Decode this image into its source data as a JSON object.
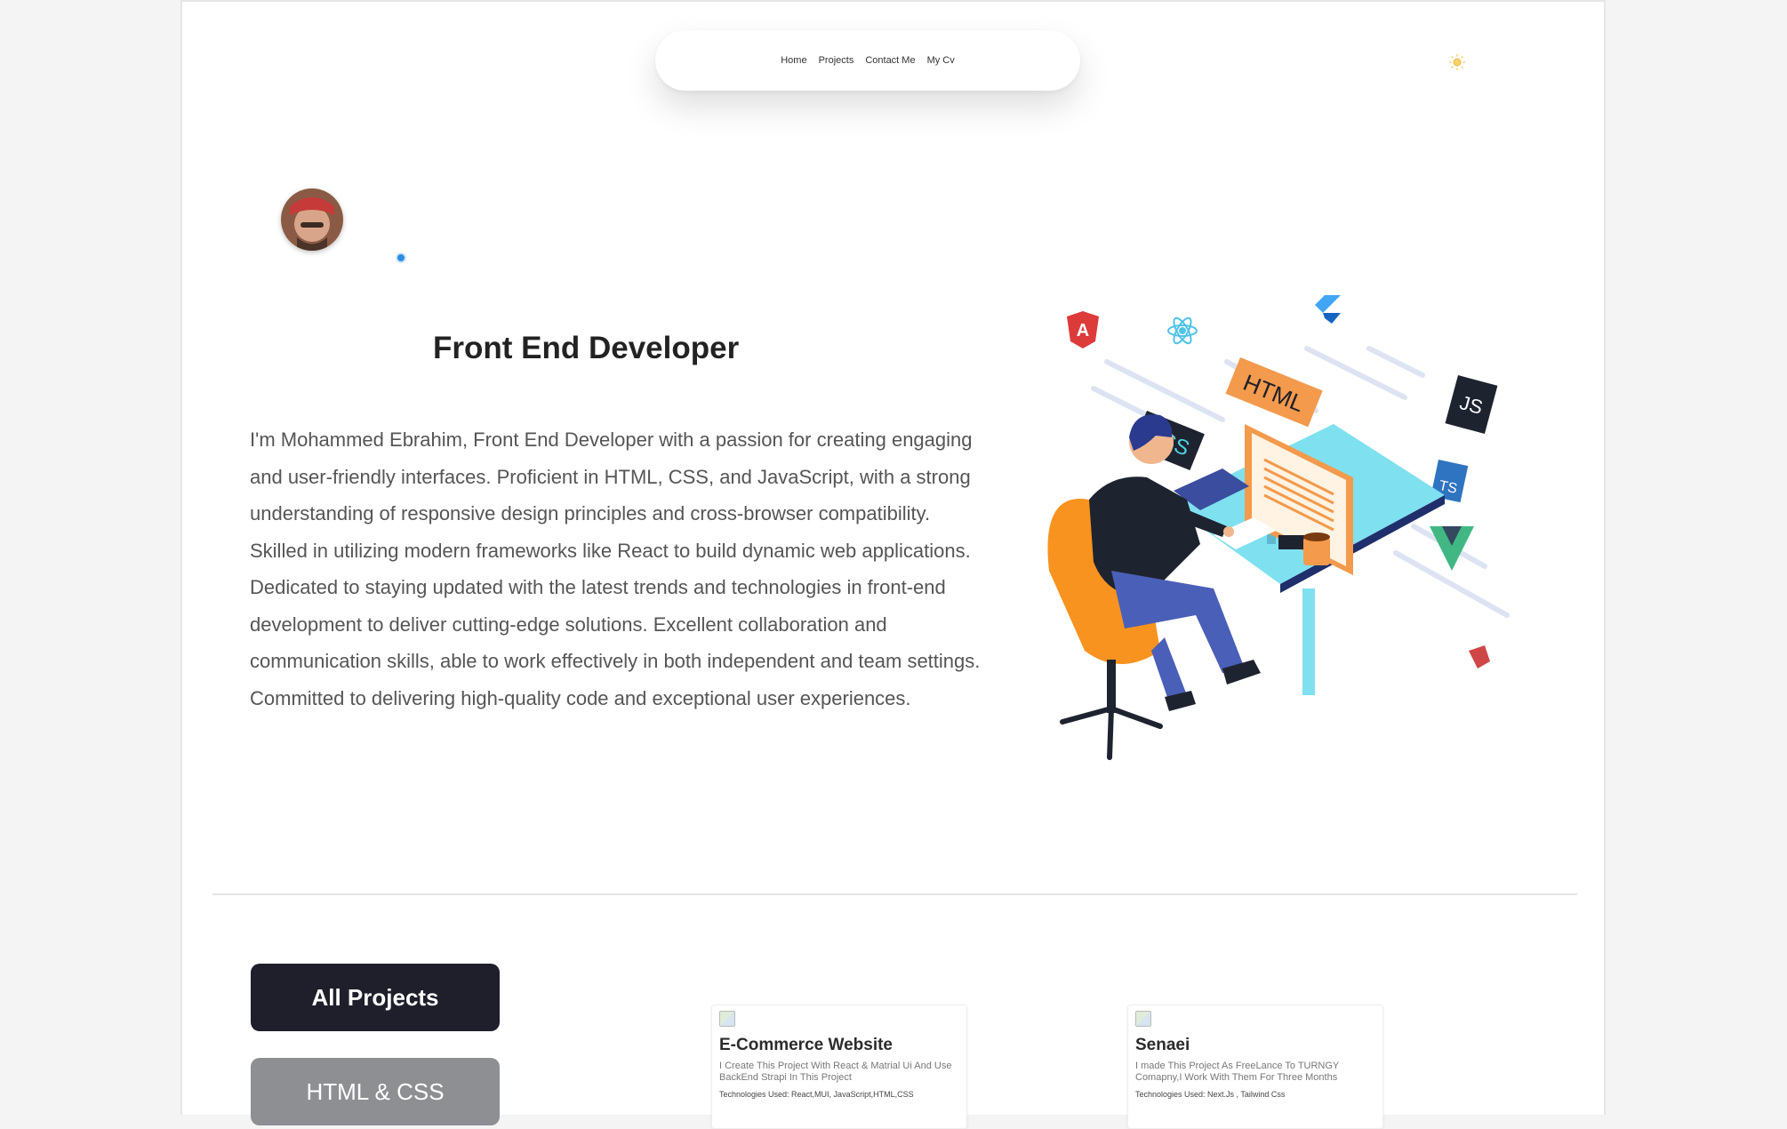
{
  "nav": {
    "links": [
      "Home",
      "Projects",
      "Contact Me",
      "My Cv"
    ],
    "theme_icon": "sun-icon"
  },
  "hero": {
    "title": "Front End Developer",
    "description": "I'm Mohammed Ebrahim, Front End Developer with a passion for creating engaging and user-friendly interfaces. Proficient in HTML, CSS, and JavaScript, with a strong understanding of responsive design principles and cross-browser compatibility. Skilled in utilizing modern frameworks like React to build dynamic web applications. Dedicated to staying updated with the latest trends and technologies in front-end development to deliver cutting-edge solutions. Excellent collaboration and communication skills, able to work effectively in both independent and team settings. Committed to delivering high-quality code and exceptional user experiences.",
    "illustration_labels": {
      "html": "HTML",
      "css": "CSS",
      "js": "JS",
      "ts": "TS",
      "angular": "A"
    }
  },
  "filters": {
    "all": "All Projects",
    "html_css": "HTML & CSS"
  },
  "projects": [
    {
      "title": "E-Commerce Website",
      "description": "I Create This Project With React & Matrial Ui And Use BackEnd Strapi In This Project",
      "tech": "Technologies Used: React,MUI, JavaScript,HTML,CSS"
    },
    {
      "title": "Senaei",
      "description": "I made This Project As FreeLance To TURNGY Comapny,I Work With Them For Three Months",
      "tech": "Technologies Used: Next.Js , Tailwind Css"
    }
  ],
  "colors": {
    "accent_dark": "#1e1f2b",
    "status_blue": "#2d8ce3",
    "chair_orange": "#f7931e"
  }
}
